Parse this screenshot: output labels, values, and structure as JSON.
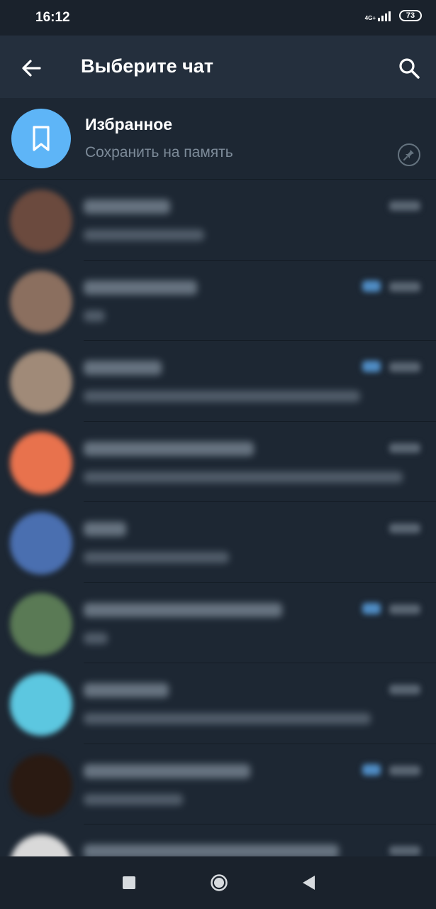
{
  "status_bar": {
    "time": "16:12",
    "network": "4G+",
    "battery": "73"
  },
  "app_bar": {
    "title": "Выберите чат",
    "back_icon": "arrow-left-icon",
    "search_icon": "search-icon"
  },
  "saved": {
    "name": "Избранное",
    "subtitle": "Сохранить на память",
    "avatar_icon": "bookmark-icon",
    "pin_icon": "pin-icon",
    "avatar_color": "#5eb5f7"
  },
  "chats": [
    {
      "avatar_color": "#6b4a3e",
      "name_w": 122,
      "msg_w": 170,
      "check": false
    },
    {
      "avatar_color": "#8b6f5f",
      "name_w": 160,
      "msg_w": 30,
      "check": true
    },
    {
      "avatar_color": "#a08a78",
      "name_w": 110,
      "msg_w": 390,
      "check": true
    },
    {
      "avatar_color": "#e8724d",
      "name_w": 240,
      "msg_w": 450,
      "check": false
    },
    {
      "avatar_color": "#4a6fb0",
      "name_w": 60,
      "msg_w": 205,
      "check": false
    },
    {
      "avatar_color": "#5a7a55",
      "name_w": 280,
      "msg_w": 34,
      "check": true
    },
    {
      "avatar_color": "#5cc7e0",
      "name_w": 120,
      "msg_w": 405,
      "check": false
    },
    {
      "avatar_color": "#2a1a12",
      "name_w": 235,
      "msg_w": 140,
      "check": true
    },
    {
      "avatar_color": "#d9d9d9",
      "name_w": 360,
      "msg_w": 0,
      "check": false
    }
  ],
  "nav_bar": {
    "recents_icon": "square-icon",
    "home_icon": "circle-home-icon",
    "back_icon": "triangle-back-icon"
  }
}
